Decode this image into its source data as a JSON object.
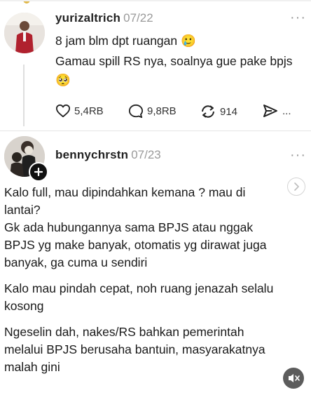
{
  "post1": {
    "username": "yurizaltrich",
    "date": "07/22",
    "line1": "8 jam blm dpt ruangan",
    "line1_emoji": "🥲",
    "line2": "Gamau spill RS nya, soalnya gue pake bpjs",
    "line3_emoji": "🥺",
    "actions": {
      "likes": "5,4RB",
      "comments": "9,8RB",
      "reposts": "914",
      "share_more": "..."
    }
  },
  "post2": {
    "username": "bennychrstn",
    "date": "07/23",
    "paragraphs": [
      "Kalo full, mau dipindahkan kemana ? mau di lantai?\nGk ada hubungannya sama BPJS atau nggak BPJS yg make banyak, otomatis yg dirawat juga banyak, ga cuma u sendiri",
      "Kalo mau pindah cepat, noh ruang jenazah selalu kosong",
      "Ngeselin dah, nakes/RS bahkan pemerintah melalui BPJS berusaha bantuin, masyarakatnya malah gini"
    ]
  },
  "icons": {
    "more": "more-dots-icon",
    "like": "heart-icon",
    "comment": "comment-bubble-icon",
    "repost": "repost-icon",
    "share": "share-arrow-icon",
    "follow": "plus-icon",
    "next": "chevron-right-icon",
    "mute": "muted-speaker-icon"
  }
}
